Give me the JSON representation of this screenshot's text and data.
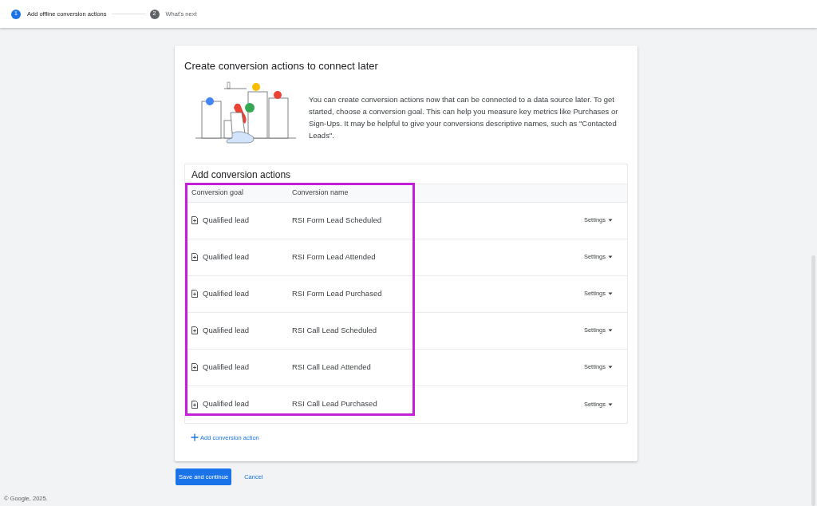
{
  "stepper": [
    {
      "number": "1",
      "label": "Add offline conversion actions",
      "active": true
    },
    {
      "number": "2",
      "label": "What's next",
      "active": false
    }
  ],
  "card": {
    "title": "Create conversion actions to connect later",
    "description": "You can create conversion actions now that can be connected to a data source later. To get started, choose a conversion goal. This can help you measure key metrics like Purchases or Sign-Ups. It may be helpful to give your conversions descriptive names, such as \"Contacted Leads\".",
    "table": {
      "title": "Add conversion actions",
      "columns": [
        "Conversion goal",
        "Conversion name"
      ],
      "rows": [
        {
          "goal": "Qualified lead",
          "name": "RSI Form Lead Scheduled",
          "settings": "Settings"
        },
        {
          "goal": "Qualified lead",
          "name": "RSI Form Lead Attended",
          "settings": "Settings"
        },
        {
          "goal": "Qualified lead",
          "name": "RSI Form Lead Purchased",
          "settings": "Settings"
        },
        {
          "goal": "Qualified lead",
          "name": "RSI Call Lead Scheduled",
          "settings": "Settings"
        },
        {
          "goal": "Qualified lead",
          "name": "RSI Call Lead Attended",
          "settings": "Settings"
        },
        {
          "goal": "Qualified lead",
          "name": "RSI Call Lead Purchased",
          "settings": "Settings"
        }
      ]
    },
    "add_link": "Add conversion action"
  },
  "buttons": {
    "primary": "Save and continue",
    "secondary": "Cancel"
  },
  "footer": "© Google, 2025."
}
